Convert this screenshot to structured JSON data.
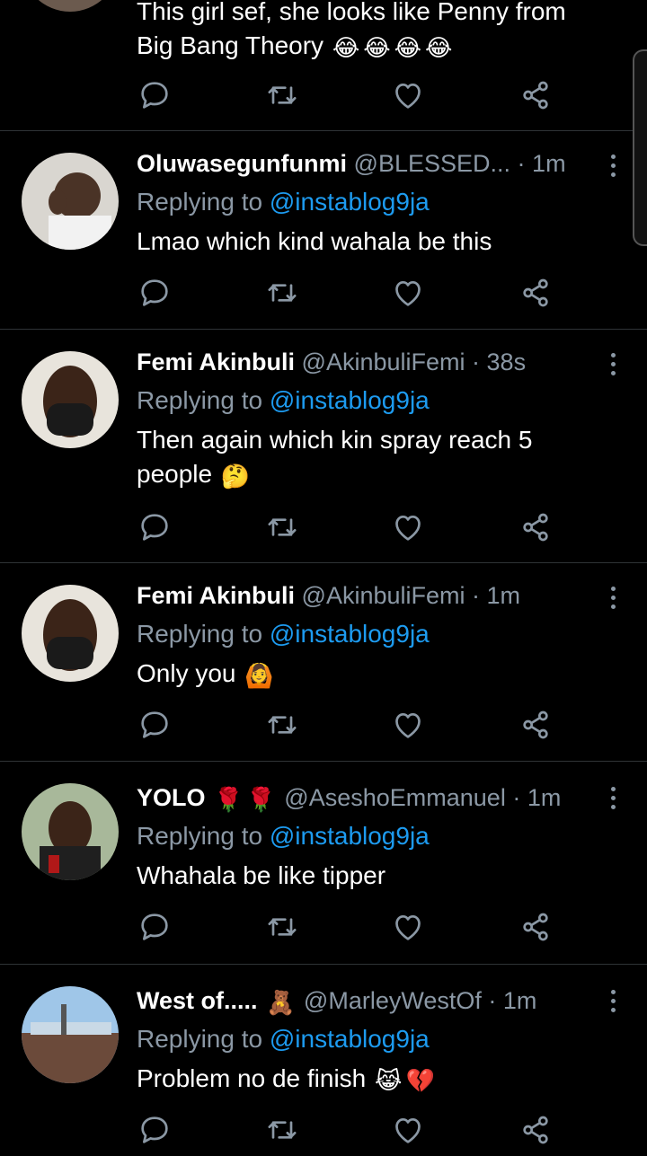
{
  "colors": {
    "background": "#000000",
    "divider": "#2f3336",
    "secondary_text": "#8b98a5",
    "mention": "#1d9bf0"
  },
  "top_tweet": {
    "lines": [
      "This girl sef, she looks like Penny from",
      "Big Bang Theory"
    ],
    "emojis": [
      "😂",
      "😂",
      "😂",
      "😂"
    ]
  },
  "tweets": [
    {
      "name": "Oluwasegunfunmi",
      "handle": "@BLESSED...",
      "time": "1m",
      "replying_prefix": "Replying to",
      "replying_to": "@instablog9ja",
      "text": "Lmao which kind wahala be this",
      "emojis": []
    },
    {
      "name": "Femi Akinbuli",
      "handle": "@AkinbuliFemi",
      "time": "38s",
      "replying_prefix": "Replying to",
      "replying_to": "@instablog9ja",
      "text_line1": "Then again which kin spray reach 5",
      "text_line2": "people",
      "emojis": [
        "🤔"
      ]
    },
    {
      "name": "Femi Akinbuli",
      "handle": "@AkinbuliFemi",
      "time": "1m",
      "replying_prefix": "Replying to",
      "replying_to": "@instablog9ja",
      "text": "Only you",
      "emojis": [
        "🙆"
      ]
    },
    {
      "name": "YOLO",
      "name_emojis": [
        "🌹",
        "🌹"
      ],
      "handle": "@AseshoEmmanuel",
      "time": "1m",
      "replying_prefix": "Replying to",
      "replying_to": "@instablog9ja",
      "text": "Whahala be like tipper",
      "emojis": []
    },
    {
      "name": "West of.....",
      "name_emojis": [
        "🧸"
      ],
      "handle": "@MarleyWestOf",
      "time": "1m",
      "replying_prefix": "Replying to",
      "replying_to": "@instablog9ja",
      "text": "Problem no de finish",
      "emojis": [
        "😹",
        "💔"
      ]
    }
  ],
  "separator": "·",
  "icons": {
    "reply": "reply-icon",
    "retweet": "retweet-icon",
    "like": "heart-icon",
    "share": "share-icon",
    "more": "more-vertical-icon"
  }
}
